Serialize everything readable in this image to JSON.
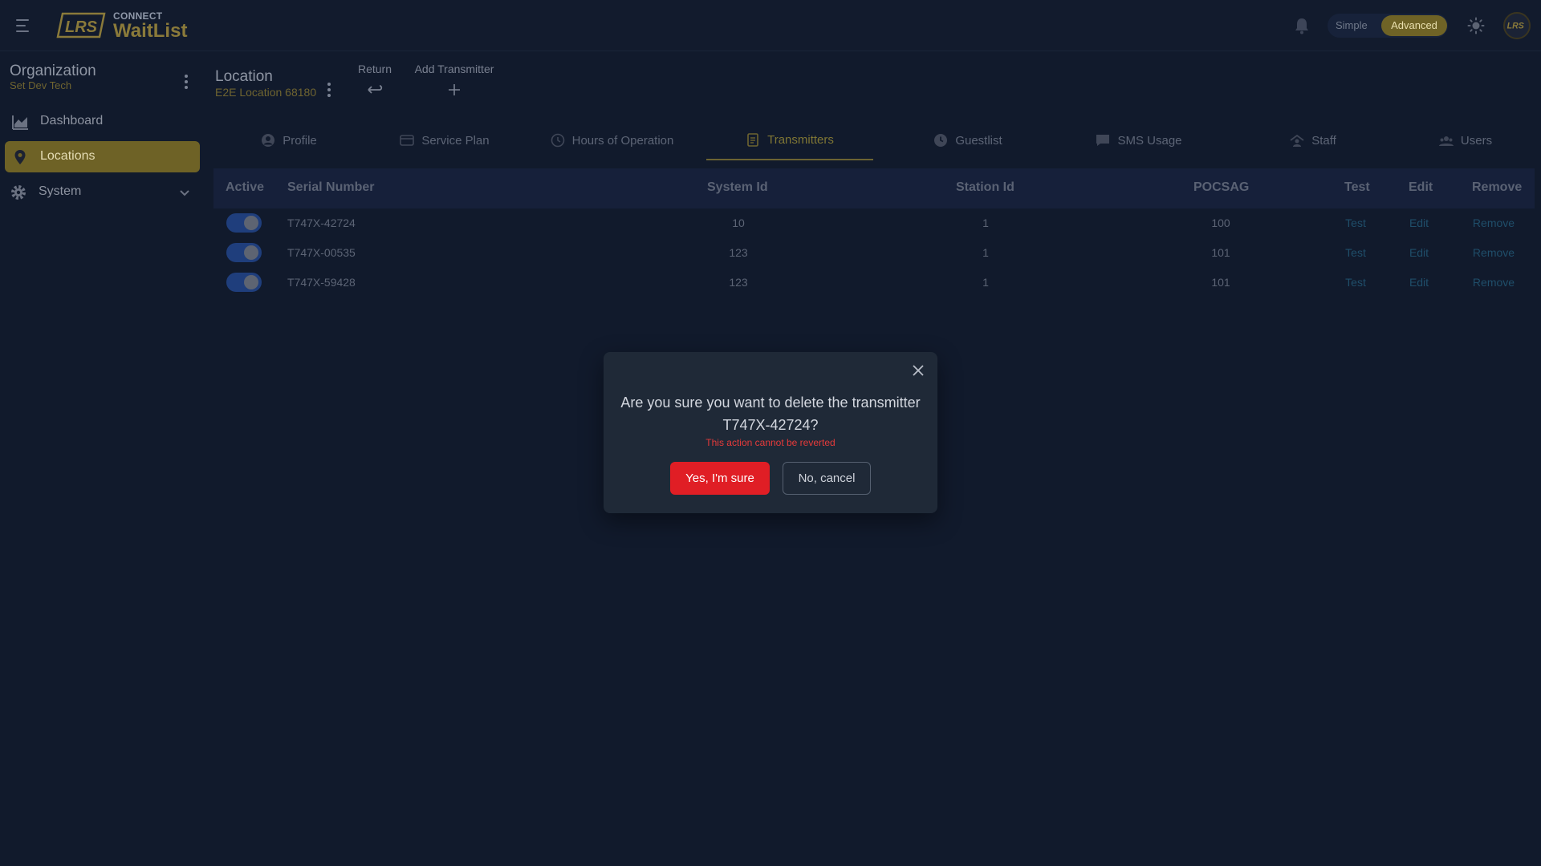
{
  "colors": {
    "accent": "#6e6226",
    "danger": "#e01e25",
    "toggle_on": "#1f3e7c",
    "link": "#1f4e6a",
    "background": "#111a2c"
  },
  "header": {
    "brand_small": "CONNECT",
    "brand_name": "WaitList",
    "logo_text": "LRS",
    "mode_simple": "Simple",
    "mode_advanced": "Advanced",
    "avatar_text": "LRS",
    "icons": [
      "hamburger-icon",
      "bell-icon",
      "sun-icon"
    ]
  },
  "sidebar": {
    "org_title": "Organization",
    "org_name": "Set Dev Tech",
    "items": [
      {
        "label": "Dashboard",
        "icon": "chart-icon"
      },
      {
        "label": "Locations",
        "icon": "map-pin-icon",
        "active": true
      },
      {
        "label": "System",
        "icon": "gear-icon",
        "expandable": true
      }
    ]
  },
  "location": {
    "title": "Location",
    "name": "E2E Location 68180",
    "actions": [
      {
        "label": "Return",
        "icon": "return-icon"
      },
      {
        "label": "Add Transmitter",
        "icon": "plus-icon"
      }
    ]
  },
  "tabs": [
    {
      "label": "Profile",
      "icon": "user-circle-icon"
    },
    {
      "label": "Service Plan",
      "icon": "card-icon"
    },
    {
      "label": "Hours of Operation",
      "icon": "clock-refresh-icon"
    },
    {
      "label": "Transmitters",
      "icon": "clipboard-icon",
      "active": true
    },
    {
      "label": "Guestlist",
      "icon": "clock-icon"
    },
    {
      "label": "SMS Usage",
      "icon": "message-icon"
    },
    {
      "label": "Staff",
      "icon": "staff-icon"
    },
    {
      "label": "Users",
      "icon": "users-icon"
    }
  ],
  "table": {
    "columns": [
      "Active",
      "Serial Number",
      "System Id",
      "Station Id",
      "POCSAG",
      "Test",
      "Edit",
      "Remove"
    ],
    "rows": [
      {
        "active": true,
        "serial": "T747X-42724",
        "system_id": "10",
        "station_id": "1",
        "pocsag": "100",
        "test": "Test",
        "edit": "Edit",
        "remove": "Remove"
      },
      {
        "active": true,
        "serial": "T747X-00535",
        "system_id": "123",
        "station_id": "1",
        "pocsag": "101",
        "test": "Test",
        "edit": "Edit",
        "remove": "Remove"
      },
      {
        "active": true,
        "serial": "T747X-59428",
        "system_id": "123",
        "station_id": "1",
        "pocsag": "101",
        "test": "Test",
        "edit": "Edit",
        "remove": "Remove"
      }
    ]
  },
  "modal": {
    "message": "Are you sure you want to delete the transmitter T747X-42724?",
    "warning": "This action cannot be reverted",
    "confirm_label": "Yes, I'm sure",
    "cancel_label": "No, cancel"
  }
}
